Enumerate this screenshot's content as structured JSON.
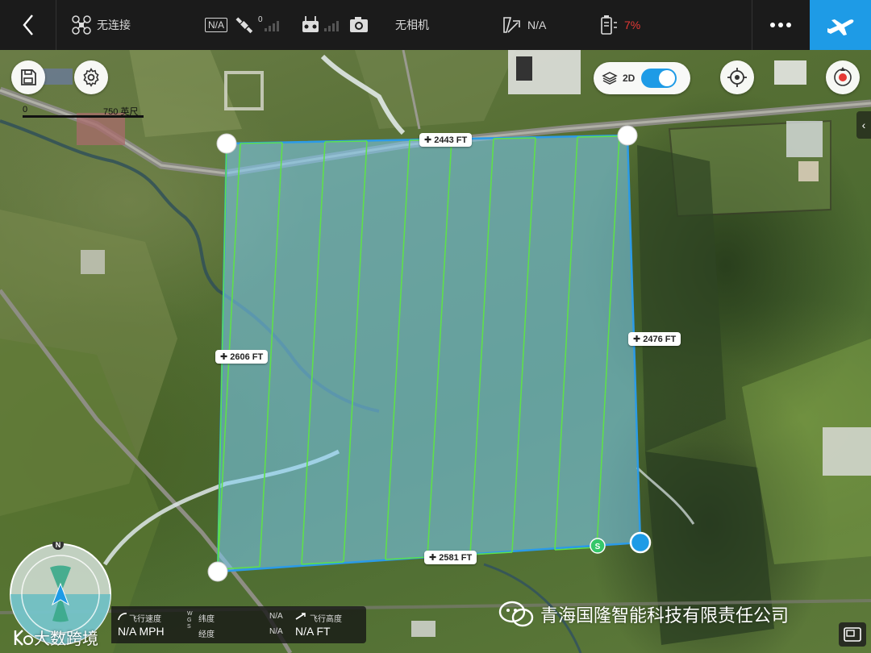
{
  "topbar": {
    "connection_label": "无连接",
    "gps_label": "N/A",
    "satellite_count": "0",
    "camera_label": "无相机",
    "distance_label": "N/A",
    "battery_label": "7%",
    "colors": {
      "background": "#1b1b1b",
      "fly_button": "#1e9be6",
      "battery_low": "#e53935"
    }
  },
  "map": {
    "scale": {
      "zero_label": "0",
      "distance_label": "750 英尺"
    },
    "view_toggle": {
      "label": "2D",
      "enabled": true
    },
    "dimensions": {
      "top": "2443 FT",
      "right": "2476 FT",
      "left": "2606 FT",
      "bottom": "2581 FT"
    },
    "start_marker": "S",
    "colors": {
      "survey_fill": "#6ec6f5",
      "survey_edge": "#2b9be8",
      "flight_lines": "#5fe04a"
    }
  },
  "telemetry": {
    "speed_label": "飞行速度",
    "speed_value": "N/A MPH",
    "lat_label": "纬度",
    "lat_value": "N/A",
    "lon_label": "经度",
    "lon_value": "N/A",
    "wgs_label": "W G S",
    "altitude_label": "飞行高度",
    "altitude_value": "N/A FT",
    "compass_north": "N"
  },
  "watermarks": {
    "company": "青海国隆智能科技有限责任公司",
    "bigdata": "大数跨境"
  }
}
